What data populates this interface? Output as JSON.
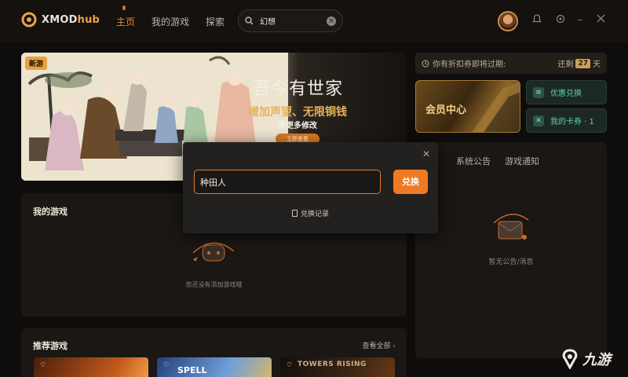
{
  "app": {
    "logo_text_a": "XMOD",
    "logo_text_b": "hub"
  },
  "nav": [
    {
      "label": "主页",
      "active": true
    },
    {
      "label": "我的游戏",
      "active": false
    },
    {
      "label": "探索",
      "active": false
    }
  ],
  "search": {
    "value": "幻想",
    "placeholder": ""
  },
  "banner": {
    "tag": "新游",
    "title": "吾今有世家",
    "subtitle": "增加声望、无限铜钱",
    "subtitle2": "等更多修改",
    "button": "立即查看"
  },
  "right": {
    "expire_text": "你有折扣券即将过期:",
    "expire_prefix": "还剩",
    "expire_days": "27",
    "expire_suffix": "天",
    "vip_label": "会员中心",
    "coupon_redeem": "优惠兑换",
    "my_coupons": "我的卡券 · 1",
    "tabs": [
      "系统公告",
      "游戏通知"
    ],
    "empty_notice": "暂无公告/消息"
  },
  "my_games": {
    "title": "我的游戏",
    "empty": "您还没有添加游戏哦"
  },
  "recommended": {
    "title": "推荐游戏",
    "see_all": "查看全部",
    "cards": [
      {
        "text": "",
        "color_a": "#5a2a10",
        "color_b": "#c25a1c"
      },
      {
        "text": "SPELL",
        "color_a": "#2f4f8f",
        "color_b": "#a7c7e8"
      },
      {
        "text": "TOWERS RISING",
        "color_a": "#1a1410",
        "color_b": "#5a3418"
      }
    ]
  },
  "modal": {
    "input_value": "种田人",
    "redeem_label": "兑换",
    "history_label": "兑换记录"
  },
  "watermark": {
    "text": "九游"
  },
  "colors": {
    "accent": "#f07a24",
    "gold": "#e8a54a",
    "bg": "#0f0d0b"
  }
}
